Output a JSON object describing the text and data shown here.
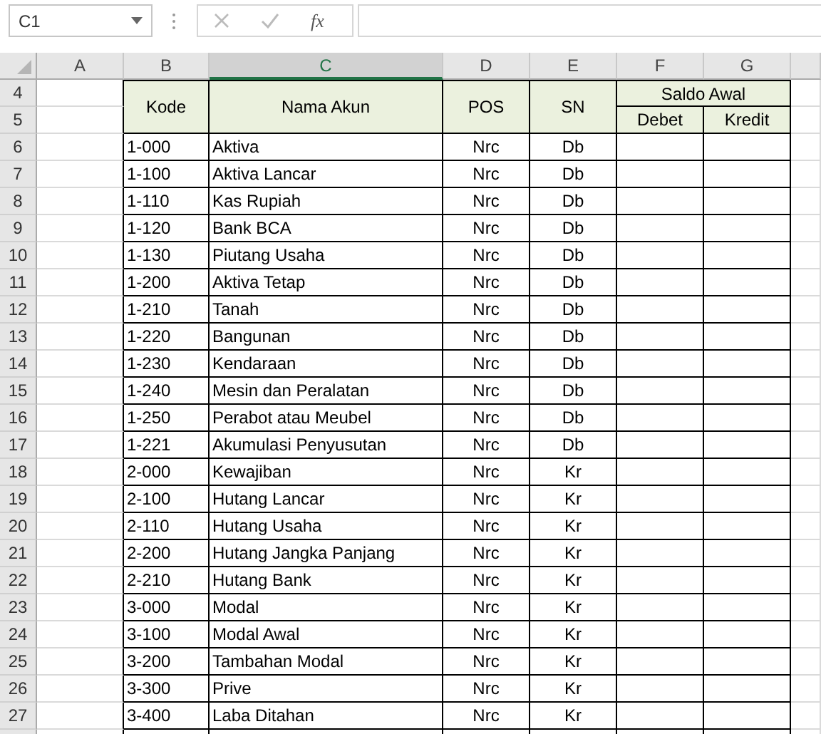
{
  "name_box": {
    "value": "C1"
  },
  "formula_bar": {
    "function_label": "fx"
  },
  "columns": [
    {
      "label": "A",
      "selected": false
    },
    {
      "label": "B",
      "selected": false
    },
    {
      "label": "C",
      "selected": true
    },
    {
      "label": "D",
      "selected": false
    },
    {
      "label": "E",
      "selected": false
    },
    {
      "label": "F",
      "selected": false
    },
    {
      "label": "G",
      "selected": false
    }
  ],
  "table": {
    "header": {
      "code": "Kode",
      "name": "Nama Akun",
      "pos": "POS",
      "sn": "SN",
      "balance_group": "Saldo Awal",
      "debit": "Debet",
      "credit": "Kredit"
    },
    "header_row_numbers": [
      "4",
      "5"
    ],
    "rows": [
      {
        "row": "6",
        "code": "1-000",
        "name": "Aktiva",
        "pos": "Nrc",
        "sn": "Db"
      },
      {
        "row": "7",
        "code": "1-100",
        "name": "Aktiva Lancar",
        "pos": "Nrc",
        "sn": "Db"
      },
      {
        "row": "8",
        "code": "1-110",
        "name": "Kas Rupiah",
        "pos": "Nrc",
        "sn": "Db"
      },
      {
        "row": "9",
        "code": "1-120",
        "name": "Bank BCA",
        "pos": "Nrc",
        "sn": "Db"
      },
      {
        "row": "10",
        "code": "1-130",
        "name": "Piutang Usaha",
        "pos": "Nrc",
        "sn": "Db"
      },
      {
        "row": "11",
        "code": "1-200",
        "name": "Aktiva Tetap",
        "pos": "Nrc",
        "sn": "Db"
      },
      {
        "row": "12",
        "code": "1-210",
        "name": "Tanah",
        "pos": "Nrc",
        "sn": "Db"
      },
      {
        "row": "13",
        "code": "1-220",
        "name": "Bangunan",
        "pos": "Nrc",
        "sn": "Db"
      },
      {
        "row": "14",
        "code": "1-230",
        "name": "Kendaraan",
        "pos": "Nrc",
        "sn": "Db"
      },
      {
        "row": "15",
        "code": "1-240",
        "name": "Mesin dan Peralatan",
        "pos": "Nrc",
        "sn": "Db"
      },
      {
        "row": "16",
        "code": "1-250",
        "name": "Perabot atau Meubel",
        "pos": "Nrc",
        "sn": "Db"
      },
      {
        "row": "17",
        "code": "1-221",
        "name": "Akumulasi Penyusutan",
        "pos": "Nrc",
        "sn": "Db"
      },
      {
        "row": "18",
        "code": "2-000",
        "name": "Kewajiban",
        "pos": "Nrc",
        "sn": "Kr"
      },
      {
        "row": "19",
        "code": "2-100",
        "name": "Hutang Lancar",
        "pos": "Nrc",
        "sn": "Kr"
      },
      {
        "row": "20",
        "code": "2-110",
        "name": "Hutang Usaha",
        "pos": "Nrc",
        "sn": "Kr"
      },
      {
        "row": "21",
        "code": "2-200",
        "name": "Hutang Jangka Panjang",
        "pos": "Nrc",
        "sn": "Kr"
      },
      {
        "row": "22",
        "code": "2-210",
        "name": "Hutang Bank",
        "pos": "Nrc",
        "sn": "Kr"
      },
      {
        "row": "23",
        "code": "3-000",
        "name": "Modal",
        "pos": "Nrc",
        "sn": "Kr"
      },
      {
        "row": "24",
        "code": "3-100",
        "name": "Modal Awal",
        "pos": "Nrc",
        "sn": "Kr"
      },
      {
        "row": "25",
        "code": "3-200",
        "name": "Tambahan Modal",
        "pos": "Nrc",
        "sn": "Kr"
      },
      {
        "row": "26",
        "code": "3-300",
        "name": "Prive",
        "pos": "Nrc",
        "sn": "Kr"
      },
      {
        "row": "27",
        "code": "3-400",
        "name": "Laba Ditahan",
        "pos": "Nrc",
        "sn": "Kr"
      }
    ]
  }
}
